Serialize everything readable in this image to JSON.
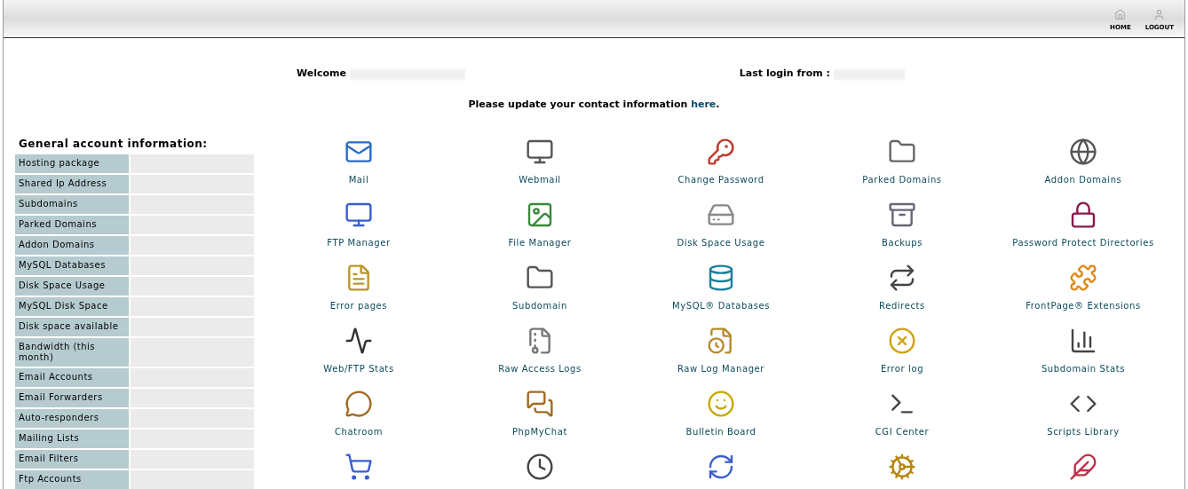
{
  "header": {
    "links": [
      {
        "label": "HOME",
        "kind": "home"
      },
      {
        "label": "LOGOUT",
        "kind": "logout"
      }
    ]
  },
  "welcome": {
    "label": "Welcome",
    "last_login_label": "Last login from :"
  },
  "notice": {
    "text": "Please update your contact information ",
    "link": "here",
    "after": "."
  },
  "account_info": {
    "title": "General account information:",
    "rows": [
      "Hosting package",
      "Shared Ip Address",
      "Subdomains",
      "Parked Domains",
      "Addon Domains",
      "MySQL Databases",
      "Disk Space Usage",
      "MySQL Disk Space",
      "Disk space available",
      "Bandwidth (this month)",
      "Email Accounts",
      "Email Forwarders",
      "Auto-responders",
      "Mailing Lists",
      "Email Filters",
      "Ftp Accounts"
    ]
  },
  "tools": [
    "Mail",
    "Webmail",
    "Change Password",
    "Parked Domains",
    "Addon Domains",
    "FTP Manager",
    "File Manager",
    "Disk Space Usage",
    "Backups",
    "Password Protect Directories",
    "Error pages",
    "Subdomain",
    "MySQL® Databases",
    "Redirects",
    "FrontPage® Extensions",
    "Web/FTP Stats",
    "Raw Access Logs",
    "Raw Log Manager",
    "Error log",
    "Subdomain Stats",
    "Chatroom",
    "PhpMyChat",
    "Bulletin Board",
    "CGI Center",
    "Scripts Library"
  ]
}
